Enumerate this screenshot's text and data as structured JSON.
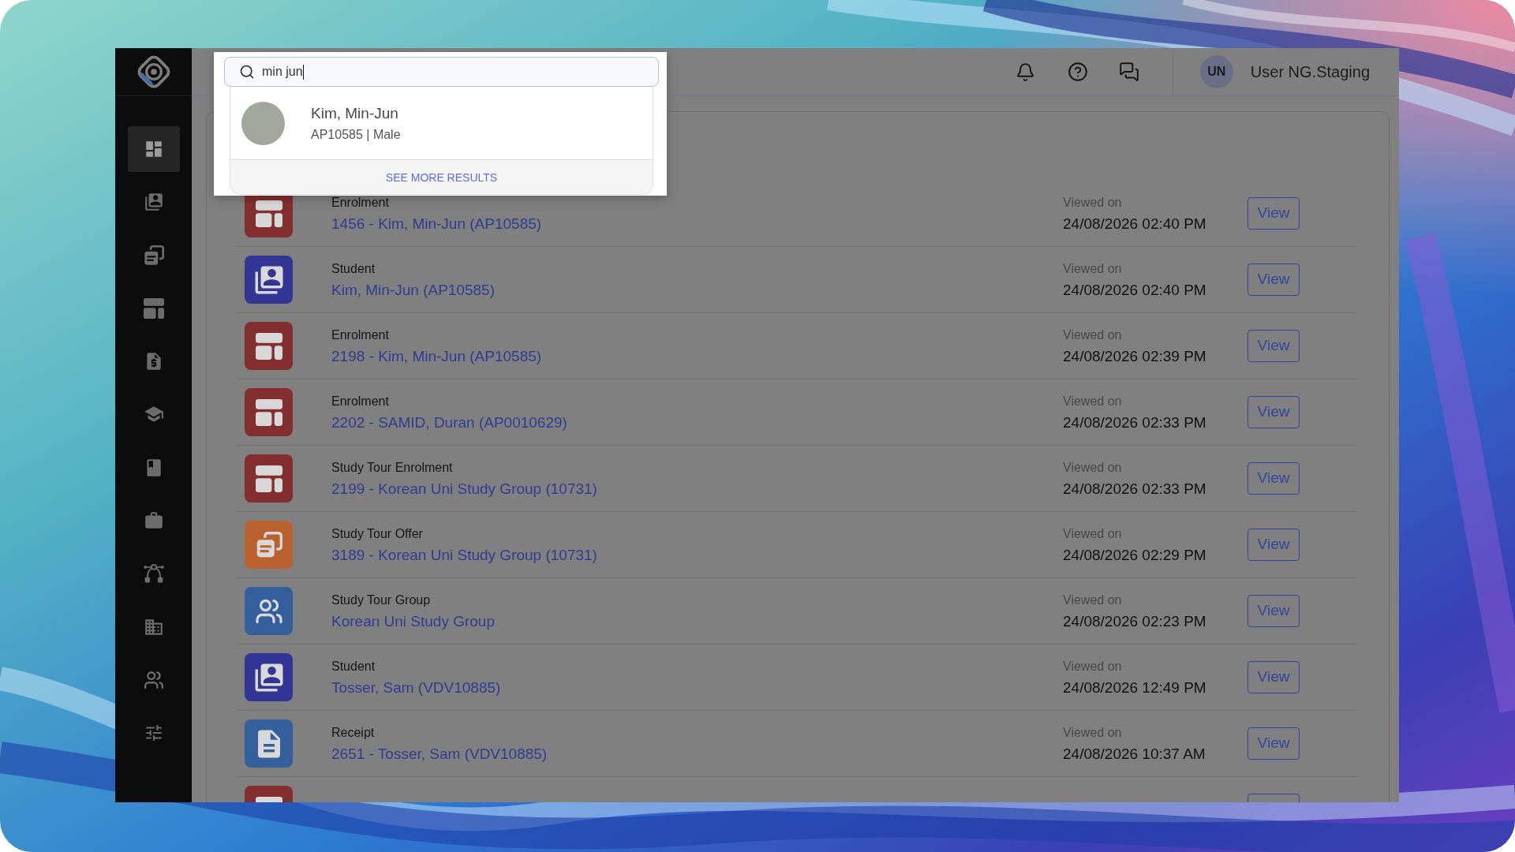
{
  "sidebar": {
    "items": [
      {
        "selected": true
      },
      {
        "selected": false
      },
      {
        "selected": false
      },
      {
        "selected": false
      },
      {
        "selected": false
      },
      {
        "selected": false
      },
      {
        "selected": false
      },
      {
        "selected": false
      },
      {
        "selected": false
      },
      {
        "selected": false
      },
      {
        "selected": false
      },
      {
        "selected": false
      }
    ]
  },
  "header": {
    "user": {
      "initials": "UN",
      "name": "User NG.Staging"
    }
  },
  "search": {
    "value": "min jun",
    "results": [
      {
        "name": "Kim, Min-Jun",
        "details": "AP10585 | Male"
      }
    ],
    "more_results": "SEE MORE RESULTS"
  },
  "recently_viewed": {
    "rows": [
      {
        "kind": "enrolment",
        "type": "Enrolment",
        "title": "1456 - Kim, Min-Jun (AP10585)",
        "viewed_label": "Viewed on",
        "viewed_at": "24/08/2026 02:40 PM",
        "action": "View"
      },
      {
        "kind": "student",
        "type": "Student",
        "title": "Kim, Min-Jun (AP10585)",
        "viewed_label": "Viewed on",
        "viewed_at": "24/08/2026 02:40 PM",
        "action": "View"
      },
      {
        "kind": "enrolment",
        "type": "Enrolment",
        "title": "2198 - Kim, Min-Jun (AP10585)",
        "viewed_label": "Viewed on",
        "viewed_at": "24/08/2026 02:39 PM",
        "action": "View"
      },
      {
        "kind": "enrolment",
        "type": "Enrolment",
        "title": "2202 - SAMID, Duran (AP0010629)",
        "viewed_label": "Viewed on",
        "viewed_at": "24/08/2026 02:33 PM",
        "action": "View"
      },
      {
        "kind": "study_tour_enrolment",
        "type": "Study Tour Enrolment",
        "title": "2199 - Korean Uni Study Group (10731)",
        "viewed_label": "Viewed on",
        "viewed_at": "24/08/2026 02:33 PM",
        "action": "View"
      },
      {
        "kind": "study_tour_offer",
        "type": "Study Tour Offer",
        "title": "3189 - Korean Uni Study Group (10731)",
        "viewed_label": "Viewed on",
        "viewed_at": "24/08/2026 02:29 PM",
        "action": "View"
      },
      {
        "kind": "study_tour_group",
        "type": "Study Tour Group",
        "title": "Korean Uni Study Group",
        "viewed_label": "Viewed on",
        "viewed_at": "24/08/2026 02:23 PM",
        "action": "View"
      },
      {
        "kind": "student",
        "type": "Student",
        "title": "Tosser, Sam (VDV10885)",
        "viewed_label": "Viewed on",
        "viewed_at": "24/08/2026 12:49 PM",
        "action": "View"
      },
      {
        "kind": "receipt",
        "type": "Receipt",
        "title": "2651 - Tosser, Sam (VDV10885)",
        "viewed_label": "Viewed on",
        "viewed_at": "24/08/2026 10:37 AM",
        "action": "View"
      },
      {
        "kind": "enrolment"
      }
    ]
  }
}
